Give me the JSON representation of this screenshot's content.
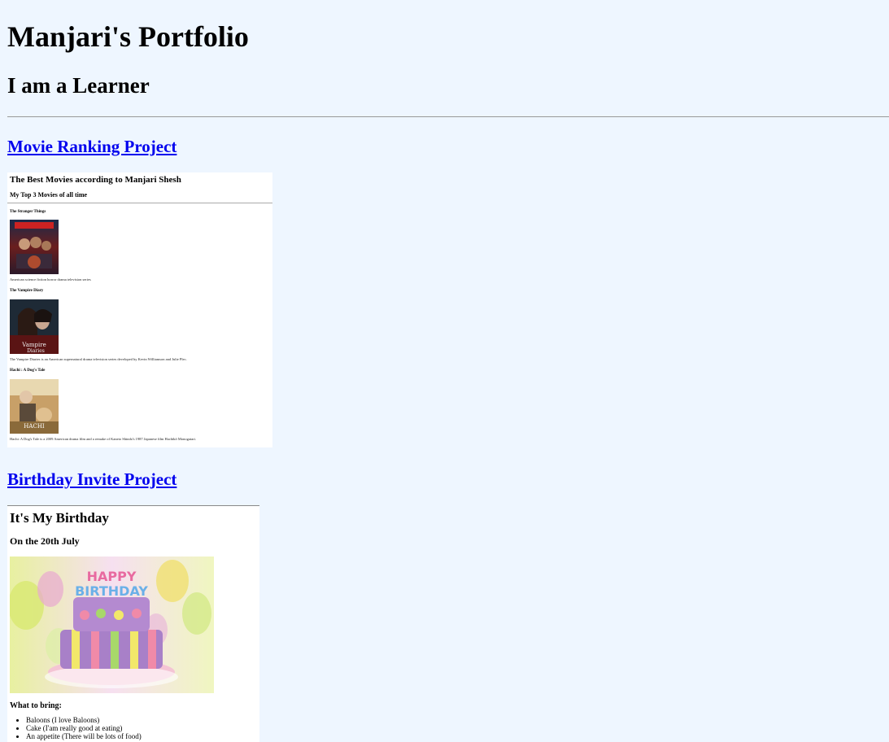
{
  "header": {
    "title": "Manjari's Portfolio",
    "subtitle": "I am a Learner"
  },
  "projects": [
    {
      "link_label": "Movie Ranking Project",
      "preview": {
        "heading": "The Best Movies according to Manjari Shesh",
        "subheading": "My Top 3 Movies of all time",
        "movies": [
          {
            "title": "The Stranger Things",
            "description": "American science fiction horror drama television series"
          },
          {
            "title": "The Vampire Diary",
            "description": "The Vampire Diaries is an American supernatural drama television series developed by Kevin Williamson and Julie Plec."
          },
          {
            "title": "Hachi : A Dog's Tale",
            "description": "Hachi: A Dog's Tale is a 2009 American drama film and a remake of Kaneto Shindo's 1987 Japanese film Hachikō Monogatari."
          }
        ]
      }
    },
    {
      "link_label": "Birthday Invite Project",
      "preview": {
        "heading": "It's My Birthday",
        "subheading": "On the 20th July",
        "what_to_bring": "What to bring:",
        "items": [
          "Baloons (I love Baloons)",
          "Cake (I'am really good at eating)",
          "An appetite (There will be lots of food)"
        ]
      }
    }
  ],
  "colors": {
    "background": "#eef6ff",
    "link": "#0000ee",
    "preview_background": "#ffffff"
  }
}
